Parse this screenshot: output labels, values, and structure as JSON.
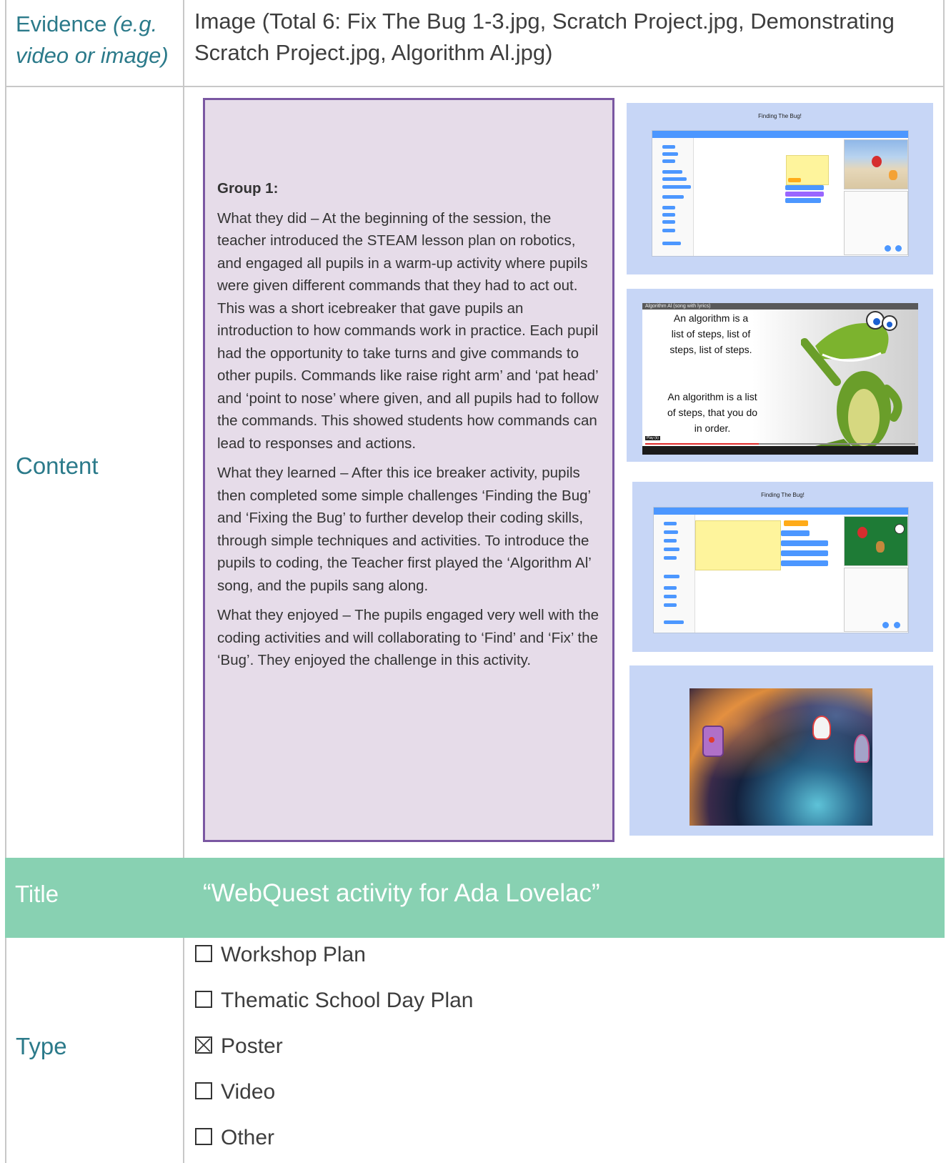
{
  "evidence": {
    "label": "Evidence",
    "label_hint": "(e.g. video or image)",
    "value": "Image (Total 6: Fix The Bug 1-3.jpg, Scratch Project.jpg, Demonstrating Scratch Project.jpg, Algorithm Al.jpg)"
  },
  "content": {
    "label": "Content",
    "group_heading": "Group 1:",
    "paragraphs": [
      "What they did – At the beginning of the session, the teacher introduced the STEAM lesson plan on robotics, and engaged all pupils in a warm-up activity where pupils were given different commands that they had to act out. This was a short icebreaker that gave pupils an introduction to how commands work in practice. Each pupil had the opportunity to take turns and give commands to other pupils. Commands like raise right arm’ and ‘pat head’ and ‘point to nose’ where given, and all pupils had to follow the commands. This showed students how commands can lead to responses and actions.",
      "What they learned – After this ice breaker activity, pupils then completed some simple challenges ‘Finding the Bug’ and ‘Fixing the Bug’ to further develop their coding skills, through simple techniques and activities. To introduce the pupils to coding, the Teacher first played the ‘Algorithm Al’ song, and the pupils sang along.",
      "What they enjoyed – The pupils engaged very well with the coding activities and will collaborating to ‘Find’ and ‘Fix’ the ‘Bug’. They enjoyed the challenge in this activity."
    ],
    "images": {
      "shot1_caption": "Finding The Bug!",
      "shot2_video_title": "Algorithm Al (song with lyrics)",
      "shot2_lyrics_1": "An algorithm is a list of steps, list of steps, list of steps.",
      "shot2_lyrics_2": "An algorithm is a list of steps, that you do in order.",
      "shot2_play_label": "Play (k)",
      "shot3_caption": "Finding The Bug!"
    }
  },
  "title_row": {
    "label": "Title",
    "value": "“WebQuest activity for Ada Lovelac”",
    "bg_color": "#88d1b2"
  },
  "type_row": {
    "label": "Type",
    "options": [
      {
        "label": "Workshop Plan",
        "checked": false
      },
      {
        "label": "Thematic School Day Plan",
        "checked": false
      },
      {
        "label": "Poster",
        "checked": true
      },
      {
        "label": "Video",
        "checked": false
      },
      {
        "label": "Other",
        "checked": false
      }
    ]
  },
  "colors": {
    "label_text": "#2b7a8a",
    "panel_border": "#7a57a2",
    "panel_bg": "#e6dce9",
    "shot_bg": "#c7d6f6"
  }
}
